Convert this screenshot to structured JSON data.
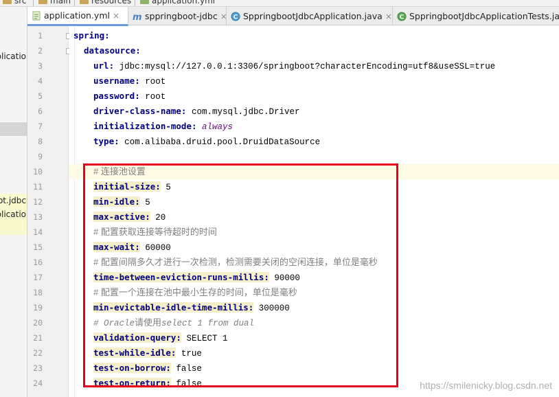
{
  "breadcrumb": {
    "items": [
      {
        "label": "src",
        "icon": "folder-icon"
      },
      {
        "label": "main",
        "icon": "folder-icon"
      },
      {
        "label": "resources",
        "icon": "folder-icon"
      },
      {
        "label": "application.yml",
        "icon": "yaml-file-icon"
      }
    ]
  },
  "tabs": [
    {
      "label": "application.yml",
      "icon": "yaml-file-icon",
      "close": "×",
      "active": true
    },
    {
      "label": "sppringboot-jdbc",
      "icon": "maven-m-icon",
      "close": "×",
      "active": false
    },
    {
      "label": "SppringbootJdbcApplication.java",
      "icon": "java-class-icon",
      "close": "×",
      "active": false
    },
    {
      "label": "SppringbootJdbcApplicationTests.java",
      "icon": "java-class-icon",
      "close": "",
      "active": false
    }
  ],
  "project_panel": {
    "rows": [
      "plicatio",
      "ot.jdbc",
      "plicatio"
    ]
  },
  "editor": {
    "line_numbers": [
      "1",
      "2",
      "3",
      "4",
      "5",
      "6",
      "7",
      "8",
      "9",
      "10",
      "11",
      "12",
      "13",
      "14",
      "15",
      "16",
      "17",
      "18",
      "19",
      "20",
      "21",
      "22",
      "23",
      "24"
    ],
    "lines": [
      {
        "key": "spring:",
        "value": ""
      },
      {
        "key": "datasource:",
        "value": ""
      },
      {
        "key": "url:",
        "value": " jdbc:mysql://127.0.0.1:3306/springboot?characterEncoding=utf8&useSSL=true"
      },
      {
        "key": "username:",
        "value": " root"
      },
      {
        "key": "password:",
        "value": " root"
      },
      {
        "key": "driver-class-name:",
        "value": " com.mysql.jdbc.Driver"
      },
      {
        "key": "initialization-mode:",
        "value": " always"
      },
      {
        "key": "type:",
        "value": " com.alibaba.druid.pool.DruidDataSource"
      },
      {
        "comment": ""
      },
      {
        "comment": "# 连接池设置"
      },
      {
        "key": "initial-size:",
        "value": " 5"
      },
      {
        "key": "min-idle:",
        "value": " 5"
      },
      {
        "key": "max-active:",
        "value": " 20"
      },
      {
        "comment": "# 配置获取连接等待超时的时间"
      },
      {
        "key": "max-wait:",
        "value": " 60000"
      },
      {
        "comment": "# 配置间隔多久才进行一次检测，检测需要关闭的空闲连接，单位是毫秒"
      },
      {
        "key": "time-between-eviction-runs-millis:",
        "value": " 90000"
      },
      {
        "comment": "# 配置一个连接在池中最小生存的时间，单位是毫秒"
      },
      {
        "key": "min-evictable-idle-time-millis:",
        "value": " 300000"
      },
      {
        "comment_a": "# Oracle",
        "comment_b": "请使用",
        "comment_c": "select 1 from dual"
      },
      {
        "key": "validation-query:",
        "value": " SELECT 1"
      },
      {
        "key": "test-while-idle:",
        "value": " true"
      },
      {
        "key": "test-on-borrow:",
        "value": " false"
      },
      {
        "key": "test-on-return:",
        "value": " false"
      }
    ]
  },
  "watermark": "https://smilenicky.blog.csdn.net",
  "colors": {
    "key": "#000080",
    "comment": "#808080",
    "enum_value": "#660e7a",
    "highlight_box": "#e8001c",
    "caret_line": "#fffae3",
    "tab_underline": "#6a9bd8"
  }
}
